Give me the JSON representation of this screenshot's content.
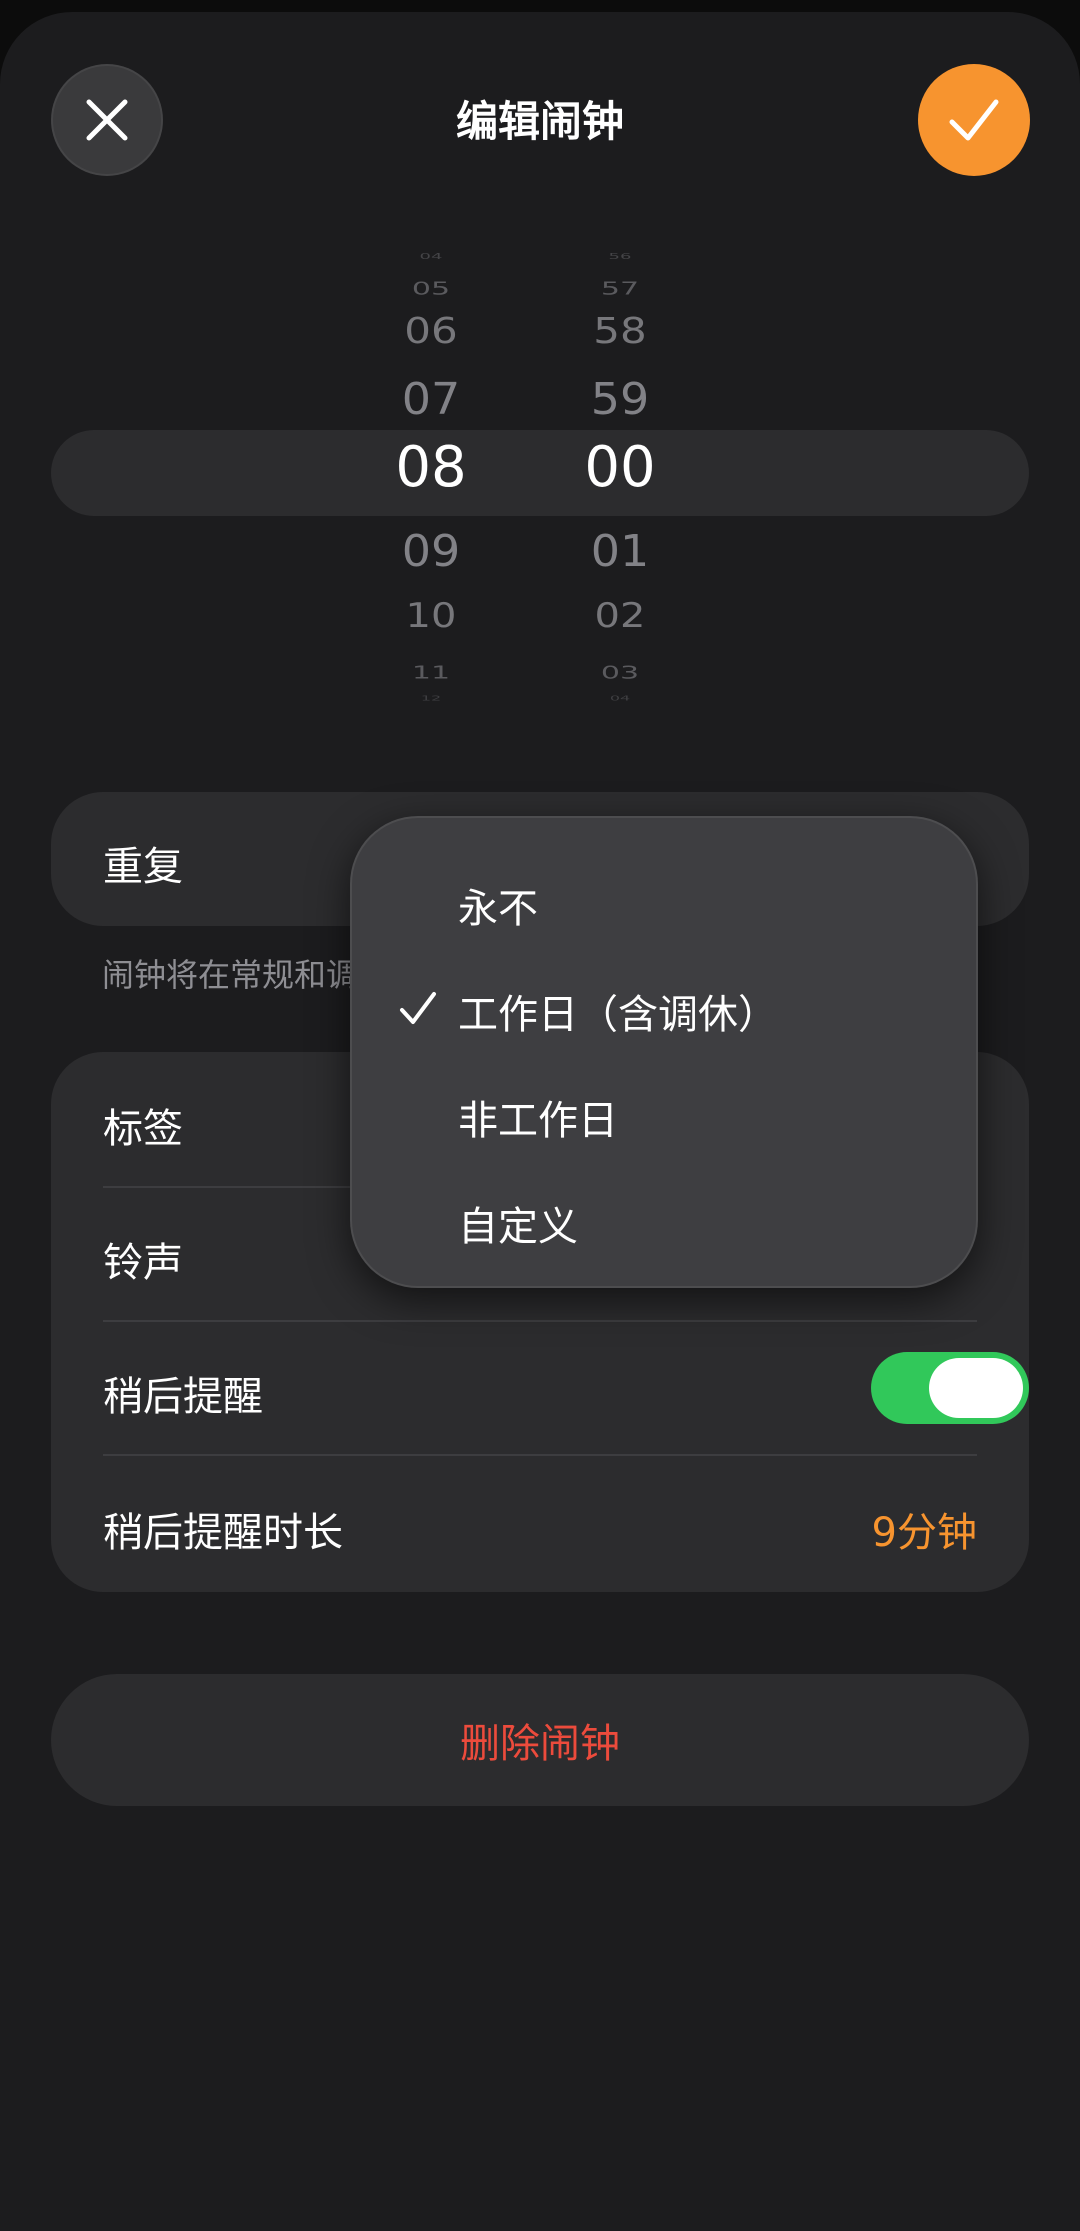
{
  "header": {
    "title": "编辑闹钟"
  },
  "picker": {
    "hours": [
      "04",
      "05",
      "06",
      "07",
      "08",
      "09",
      "10",
      "11",
      "12"
    ],
    "minutes": [
      "56",
      "57",
      "58",
      "59",
      "00",
      "01",
      "02",
      "03",
      "04"
    ],
    "selected_hour": "08",
    "selected_minute": "00"
  },
  "repeat": {
    "label": "重复",
    "hint": "闹钟将在常规和调"
  },
  "settings": {
    "label_row": "标签",
    "ringtone_row": "铃声",
    "snooze_row": "稍后提醒",
    "snooze_enabled": true,
    "snooze_duration_row": "稍后提醒时长",
    "snooze_duration_value": "9分钟"
  },
  "delete": {
    "label": "删除闹钟"
  },
  "repeat_menu": {
    "items": [
      {
        "label": "永不",
        "checked": false
      },
      {
        "label": "工作日（含调休）",
        "checked": true
      },
      {
        "label": "非工作日",
        "checked": false
      },
      {
        "label": "自定义",
        "checked": false
      }
    ]
  },
  "colors": {
    "accent": "#f7942f",
    "toggle_on": "#31c85a",
    "destructive": "#ec4b3c"
  }
}
